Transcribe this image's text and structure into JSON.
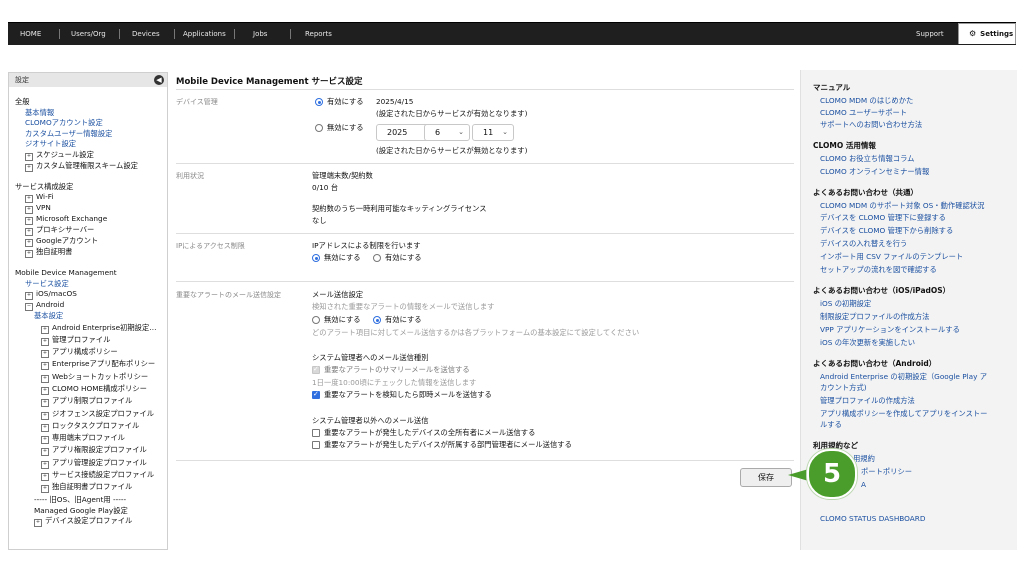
{
  "nav": {
    "items": [
      "HOME",
      "Users/Org",
      "Devices",
      "Applications",
      "Jobs",
      "Reports"
    ],
    "support": "Support",
    "settings": "Settings"
  },
  "sidebar": {
    "header": "設定",
    "general": {
      "title": "全般",
      "links": [
        "基本情報",
        "CLOMOアカウント設定",
        "カスタムユーザー情報設定",
        "ジオサイト設定"
      ],
      "expandables": [
        "スケジュール設定",
        "カスタム管理権限スキーム設定"
      ]
    },
    "service": {
      "title": "サービス構成設定",
      "items": [
        "Wi-Fi",
        "VPN",
        "Microsoft Exchange",
        "プロキシサーバー",
        "Googleアカウント",
        "独自証明書"
      ]
    },
    "mdm": {
      "title": "Mobile Device Management",
      "service_link": "サービス設定",
      "ios": "iOS/macOS",
      "android": "Android",
      "basic_link": "基本設定",
      "profiles": [
        "Android Enterprise初期設定…",
        "管理プロファイル",
        "アプリ構成ポリシー",
        "Enterpriseアプリ配布ポリシー",
        "Webショートカットポリシー",
        "CLOMO HOME構成ポリシー",
        "アプリ制限プロファイル",
        "ジオフェンス設定プロファイル",
        "ロックタスクプロファイル",
        "専用端末プロファイル",
        "アプリ権限設定プロファイル",
        "アプリ管理設定プロファイル",
        "サービス接続設定プロファイル",
        "独自証明書プロファイル"
      ],
      "legacy": "----- 旧OS、旧Agent用 -----",
      "managed_play": "Managed Google Play設定",
      "device_profile": "デバイス設定プロファイル"
    }
  },
  "main": {
    "title": "Mobile Device Management サービス設定",
    "device_mgmt": {
      "label": "デバイス管理",
      "enable": "有効にする",
      "enable_date": "2025/4/15",
      "enable_note": "(設定された日からサービスが有効となります)",
      "disable": "無効にする",
      "year": "2025",
      "month": "6",
      "day": "11",
      "disable_note": "(設定された日からサービスが無効となります)"
    },
    "usage": {
      "label": "利用状況",
      "devices_title": "管理端末数/契約数",
      "devices_value": "0/10 台",
      "kitting_title": "契約数のうち一時利用可能なキッティングライセンス",
      "kitting_value": "なし"
    },
    "ip": {
      "label": "IPによるアクセス制限",
      "title": "IPアドレスによる制限を行います",
      "disable": "無効にする",
      "enable": "有効にする"
    },
    "alert": {
      "label": "重要なアラートのメール送信設定",
      "mail_title": "メール送信設定",
      "mail_desc": "検知された重要なアラートの情報をメールで送信します",
      "disable": "無効にする",
      "enable": "有効にする",
      "platform_note": "どのアラート項目に対してメール送信するかは各プラットフォームの基本設定にて設定してください",
      "admin_title": "システム管理者へのメール送信種別",
      "summary": "重要なアラートのサマリーメールを送信する",
      "summary_note": "1日一度10:00頃にチェックした情報を送信します",
      "immediate": "重要なアラートを検知したら即時メールを送信する",
      "other_title": "システム管理者以外へのメール送信",
      "owners": "重要なアラートが発生したデバイスの全所有者にメール送信する",
      "dept": "重要なアラートが発生したデバイスが所属する部門管理者にメール送信する"
    },
    "save": "保存",
    "callout": "5"
  },
  "right": {
    "manual": {
      "title": "マニュアル",
      "links": [
        "CLOMO MDM のはじめかた",
        "CLOMO ユーザーサポート",
        "サポートへのお問い合わせ方法"
      ]
    },
    "info": {
      "title": "CLOMO 活用情報",
      "links": [
        "CLOMO お役立ち情報コラム",
        "CLOMO オンラインセミナー情報"
      ]
    },
    "faq_common": {
      "title": "よくあるお問い合わせ（共通）",
      "links": [
        "CLOMO MDM のサポート対象 OS・動作確認状況",
        "デバイスを CLOMO 管理下に登録する",
        "デバイスを CLOMO 管理下から削除する",
        "デバイスの入れ替えを行う",
        "インポート用 CSV ファイルのテンプレート",
        "セットアップの流れを図で確認する"
      ]
    },
    "faq_ios": {
      "title": "よくあるお問い合わせ（iOS/iPadOS）",
      "links": [
        "iOS の初期設定",
        "制限設定プロファイルの作成方法",
        "VPP アプリケーションをインストールする",
        "iOS の年次更新を実施したい"
      ]
    },
    "faq_android": {
      "title": "よくあるお問い合わせ（Android）",
      "links": [
        "Android Enterprise の初期設定（Google Play ア",
        "カウント方式)",
        "管理プロファイルの作成方法",
        "アプリ構成ポリシーを作成してアプリをインストー",
        "ルする"
      ]
    },
    "terms": {
      "title": "利用規約など",
      "links": [
        "用規約",
        "ポートポリシー",
        "A"
      ]
    },
    "status": "CLOMO STATUS DASHBOARD"
  }
}
